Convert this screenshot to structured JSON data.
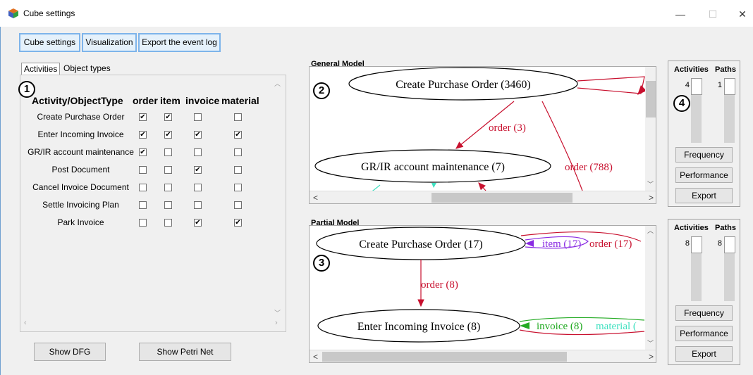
{
  "window": {
    "title": "Cube settings",
    "minimize": "—",
    "maximize": "☐",
    "close": "✕"
  },
  "toolbar": {
    "buttons": [
      "Cube settings",
      "Visualization",
      "Export the event log"
    ]
  },
  "tabs": [
    "Activities",
    "Object types"
  ],
  "table": {
    "header": [
      "Activity/ObjectType",
      "order",
      "item",
      "invoice",
      "material"
    ],
    "rows": [
      {
        "label": "Create Purchase Order",
        "checks": [
          true,
          true,
          false,
          false
        ]
      },
      {
        "label": "Enter Incoming Invoice",
        "checks": [
          true,
          true,
          true,
          true
        ]
      },
      {
        "label": "GR/IR account maintenance",
        "checks": [
          true,
          false,
          false,
          false
        ]
      },
      {
        "label": "Post Document",
        "checks": [
          false,
          false,
          true,
          false
        ]
      },
      {
        "label": "Cancel Invoice Document",
        "checks": [
          false,
          false,
          false,
          false
        ]
      },
      {
        "label": "Settle Invoicing Plan",
        "checks": [
          false,
          false,
          false,
          false
        ]
      },
      {
        "label": "Park Invoice",
        "checks": [
          false,
          false,
          true,
          true
        ]
      }
    ]
  },
  "bottom_buttons": {
    "show_dfg": "Show DFG",
    "show_petri": "Show Petri Net"
  },
  "markers": [
    "1",
    "2",
    "3",
    "4"
  ],
  "general_model": {
    "label": "General Model",
    "nodes": [
      "Create Purchase Order (3460)",
      "GR/IR account maintenance (7)"
    ],
    "edges": [
      "order (3)",
      "order (788)"
    ]
  },
  "partial_model": {
    "label": "Partial Model",
    "nodes": [
      "Create Purchase Order (17)",
      "Enter Incoming Invoice (8)"
    ],
    "edges": [
      "order (8)",
      "item (17)",
      "order (17)",
      "invoice (8)",
      "material ("
    ]
  },
  "general_controls": {
    "activities_label": "Activities",
    "paths_label": "Paths",
    "activities_value": "4",
    "paths_value": "1",
    "buttons": [
      "Frequency",
      "Performance",
      "Export"
    ]
  },
  "partial_controls": {
    "activities_label": "Activities",
    "paths_label": "Paths",
    "activities_value": "8",
    "paths_value": "8",
    "buttons": [
      "Frequency",
      "Performance",
      "Export"
    ]
  },
  "colors": {
    "edge_red": "#c8102e",
    "edge_purple": "#8a2be2",
    "edge_green": "#22aa22",
    "edge_teal": "#40e0c0",
    "focus_blue": "#7eb4ea"
  },
  "icons": {
    "app": "cube-icon",
    "check": "checkmark"
  }
}
